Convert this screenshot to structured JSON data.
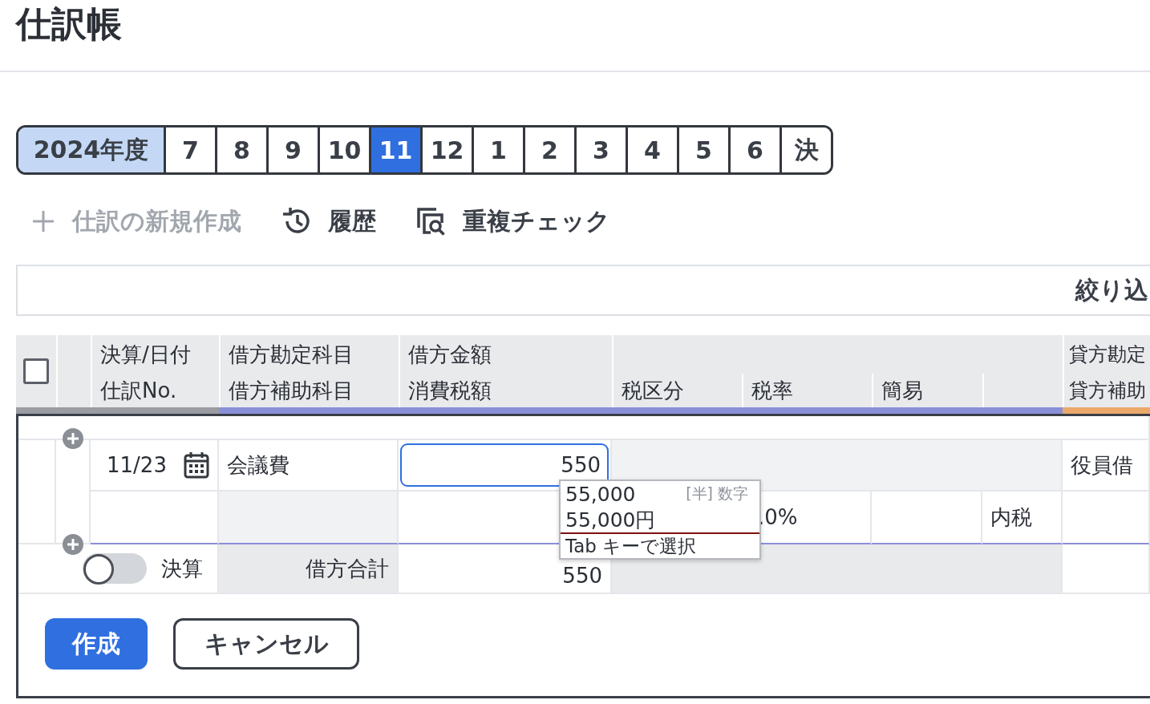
{
  "title": "仕訳帳",
  "periods": [
    {
      "label": "2024年度",
      "kind": "year",
      "selected": false
    },
    {
      "label": "7",
      "kind": "month",
      "selected": false
    },
    {
      "label": "8",
      "kind": "month",
      "selected": false
    },
    {
      "label": "9",
      "kind": "month",
      "selected": false
    },
    {
      "label": "10",
      "kind": "month",
      "selected": false
    },
    {
      "label": "11",
      "kind": "month",
      "selected": true
    },
    {
      "label": "12",
      "kind": "month",
      "selected": false
    },
    {
      "label": "1",
      "kind": "month",
      "selected": false
    },
    {
      "label": "2",
      "kind": "month",
      "selected": false
    },
    {
      "label": "3",
      "kind": "month",
      "selected": false
    },
    {
      "label": "4",
      "kind": "month",
      "selected": false
    },
    {
      "label": "5",
      "kind": "month",
      "selected": false
    },
    {
      "label": "6",
      "kind": "month",
      "selected": false
    },
    {
      "label": "決",
      "kind": "closing",
      "selected": false
    }
  ],
  "toolbar": [
    {
      "label": "仕訳の新規作成",
      "kind": "plus",
      "disabled": true
    },
    {
      "label": "履歴",
      "kind": "history",
      "disabled": false
    },
    {
      "label": "重複チェック",
      "kind": "duplicate",
      "disabled": false
    }
  ],
  "filter": {
    "label": "絞り込"
  },
  "table": {
    "select_all": {
      "checked": false
    },
    "header_top": [
      "決算/日付",
      "借方勘定科目",
      "借方金額",
      "貸方勘定"
    ],
    "header_bottom": [
      "仕訳No.",
      "借方補助科目",
      "消費税額",
      "税区分",
      "税率",
      "簡易",
      "貸方補助"
    ]
  },
  "entry": {
    "date": "11/23",
    "debit_account": "会議費",
    "debit_amount": "550",
    "tax_rate": ".0%",
    "tax_type": "内税",
    "credit_account": "役員借"
  },
  "suggestions": {
    "options": [
      {
        "label": "55,000",
        "hint": "[半] 数字"
      },
      {
        "label": "55,000円"
      }
    ],
    "footer": "Tab キーで選択"
  },
  "totals": {
    "settlement": {
      "label": "決算",
      "on": false
    },
    "label": "借方合計",
    "value": "550"
  },
  "buttons": [
    {
      "label": "作成",
      "kind": "primary"
    },
    {
      "label": "キャンセル",
      "kind": "secondary"
    }
  ]
}
